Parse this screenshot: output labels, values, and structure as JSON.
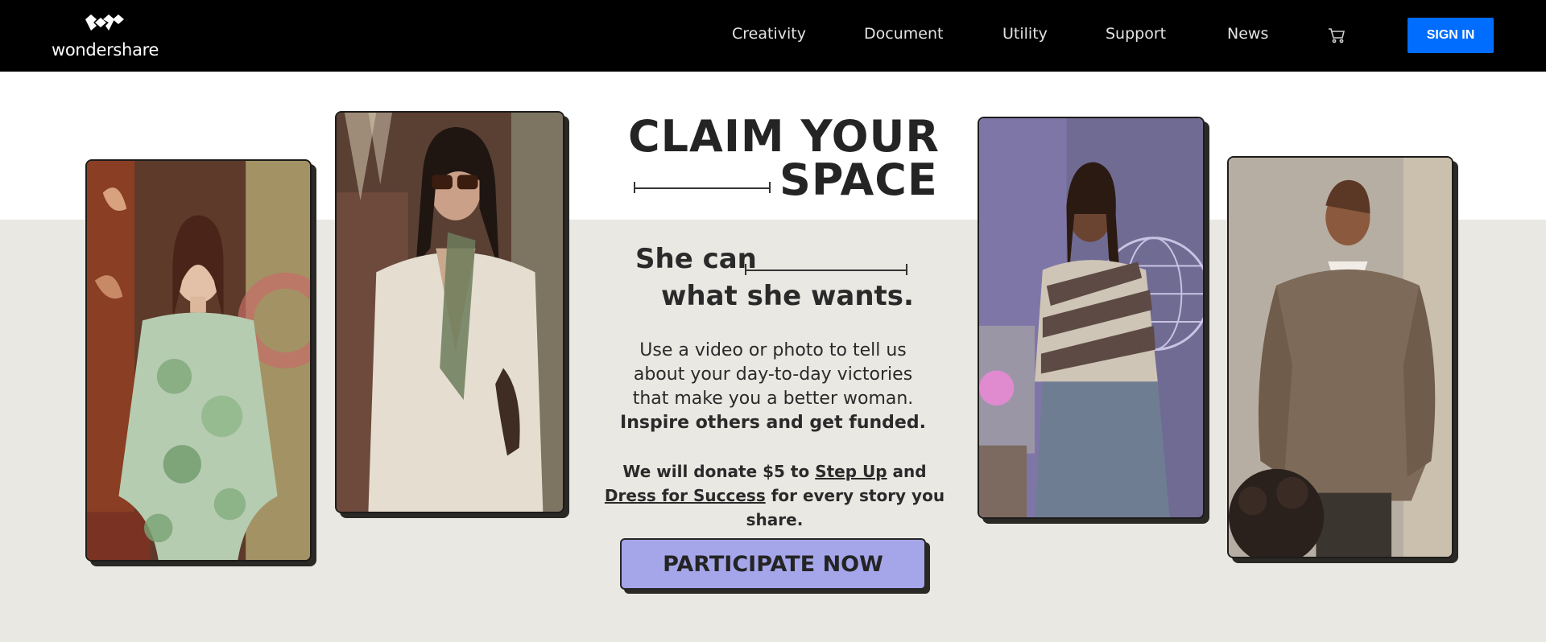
{
  "brand": {
    "name": "wondershare",
    "logo_icon": "wondershare-diamond-mark"
  },
  "nav": {
    "items": [
      {
        "label": "Creativity"
      },
      {
        "label": "Document"
      },
      {
        "label": "Utility"
      },
      {
        "label": "Support"
      },
      {
        "label": "News"
      }
    ],
    "cart_icon": "cart-icon",
    "signin_label": "SIGN IN"
  },
  "hero": {
    "title_line1": "CLAIM YOUR",
    "title_line2": "SPACE",
    "subtitle_line1": "She can",
    "subtitle_line2": "what she wants.",
    "body_line1": "Use a video or photo to tell us",
    "body_line2": "about your day-to-day victories",
    "body_line3": "that make you a better woman.",
    "body_strong": "Inspire others and get funded.",
    "donate_prefix": "We will donate $5 to",
    "donate_link1": "Step Up",
    "donate_and": "and",
    "donate_link2": "Dress for Success",
    "donate_suffix": "for every story you share.",
    "cta_label": "PARTICIPATE NOW"
  },
  "colors": {
    "navbar_bg": "#000000",
    "signin_bg": "#006dff",
    "band_bg": "#eae8e3",
    "cta_bg": "#a5a6ea"
  },
  "photos": [
    {
      "name": "woman-green-floral-dress"
    },
    {
      "name": "woman-white-blazer-sunglasses"
    },
    {
      "name": "woman-striped-top-jeans"
    },
    {
      "name": "woman-brown-sweater-dog"
    }
  ]
}
